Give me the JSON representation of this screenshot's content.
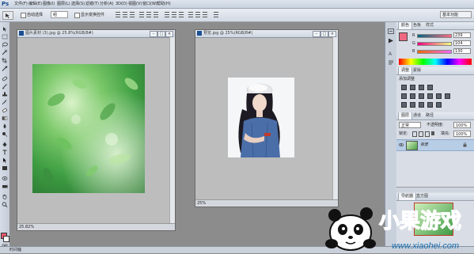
{
  "app": {
    "logo": "Ps"
  },
  "menu": [
    "文件(F)",
    "编辑(E)",
    "图像(I)",
    "图层(L)",
    "选择(S)",
    "滤镜(T)",
    "分析(A)",
    "3D(D)",
    "视图(V)",
    "窗口(W)",
    "帮助(H)"
  ],
  "options": {
    "auto_select_label": "自动选择",
    "auto_select_target": "组",
    "show_transform_label": "显示变换控件",
    "workspace_selector": "基本功能"
  },
  "documents": [
    {
      "title": "图片素材 (3).jpg @ 25.8%(RGB/8#)",
      "zoom": "25.82%"
    },
    {
      "title": "预览.jpg @ 25%(RGB/8#)",
      "zoom": "25%"
    }
  ],
  "color_panel": {
    "tabs": [
      "颜色",
      "色板",
      "样式"
    ],
    "rows": [
      {
        "label": "R",
        "value": "239"
      },
      {
        "label": "G",
        "value": "104"
      },
      {
        "label": "B",
        "value": "130"
      }
    ],
    "fg_color": "#ef6882"
  },
  "adjust_panel": {
    "tabs": [
      "调整",
      "蒙版"
    ],
    "title": "添加调整"
  },
  "layers_panel": {
    "tabs": [
      "图层",
      "通道",
      "路径"
    ],
    "blend_mode": "正常",
    "opacity_label": "不透明度:",
    "opacity": "100%",
    "lock_label": "锁定:",
    "fill_label": "填充:",
    "fill": "100%",
    "layers": [
      {
        "name": "背景"
      }
    ]
  },
  "navigator_panel": {
    "tabs": [
      "导航器",
      "直方图"
    ]
  },
  "statusbar": {
    "label": "时间轴"
  },
  "watermark": {
    "brand_text": "小果游戏",
    "url": "www.xiaohei.com"
  },
  "colors": {
    "accent": "#1b4f91",
    "layer_selected": "#b8cde6"
  }
}
